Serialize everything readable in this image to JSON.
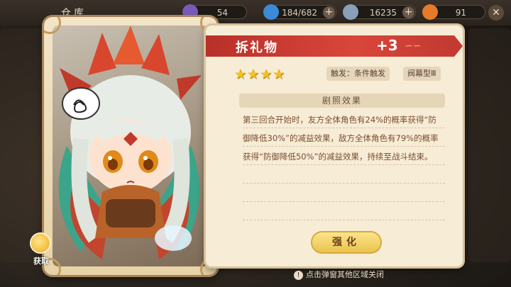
{
  "topbar": {
    "title": "仓库",
    "resources": [
      {
        "value": "54",
        "icon": "purple-gem-icon",
        "color": "#7a5ab8"
      },
      {
        "value": "184/682",
        "icon": "stamina-bottle-icon",
        "color": "#3b8ad8"
      },
      {
        "value": "16235",
        "icon": "coin-icon",
        "color": "#8aa0b8"
      },
      {
        "value": "91",
        "icon": "carrot-icon",
        "color": "#e57a2a"
      }
    ]
  },
  "item": {
    "name": "拆礼物",
    "level": "+3",
    "stars": 4,
    "trigger_tag": "触发：条件触发",
    "type_tag": "阀幕型Ⅲ"
  },
  "effect": {
    "title": "剧照效果",
    "text": "第三回合开始时，友方全体角色有24%的概率获得“防御降低30%”的减益效果，敌方全体角色有79%的概率获得“防御降低50%”的减益效果，持续至战斗结束。"
  },
  "buttons": {
    "enhance": "强化",
    "get": "获取"
  },
  "hint": "点击弹窗其他区域关闭",
  "colors": {
    "header_red": "#d9463a",
    "accent_gold": "#f4c11f"
  }
}
